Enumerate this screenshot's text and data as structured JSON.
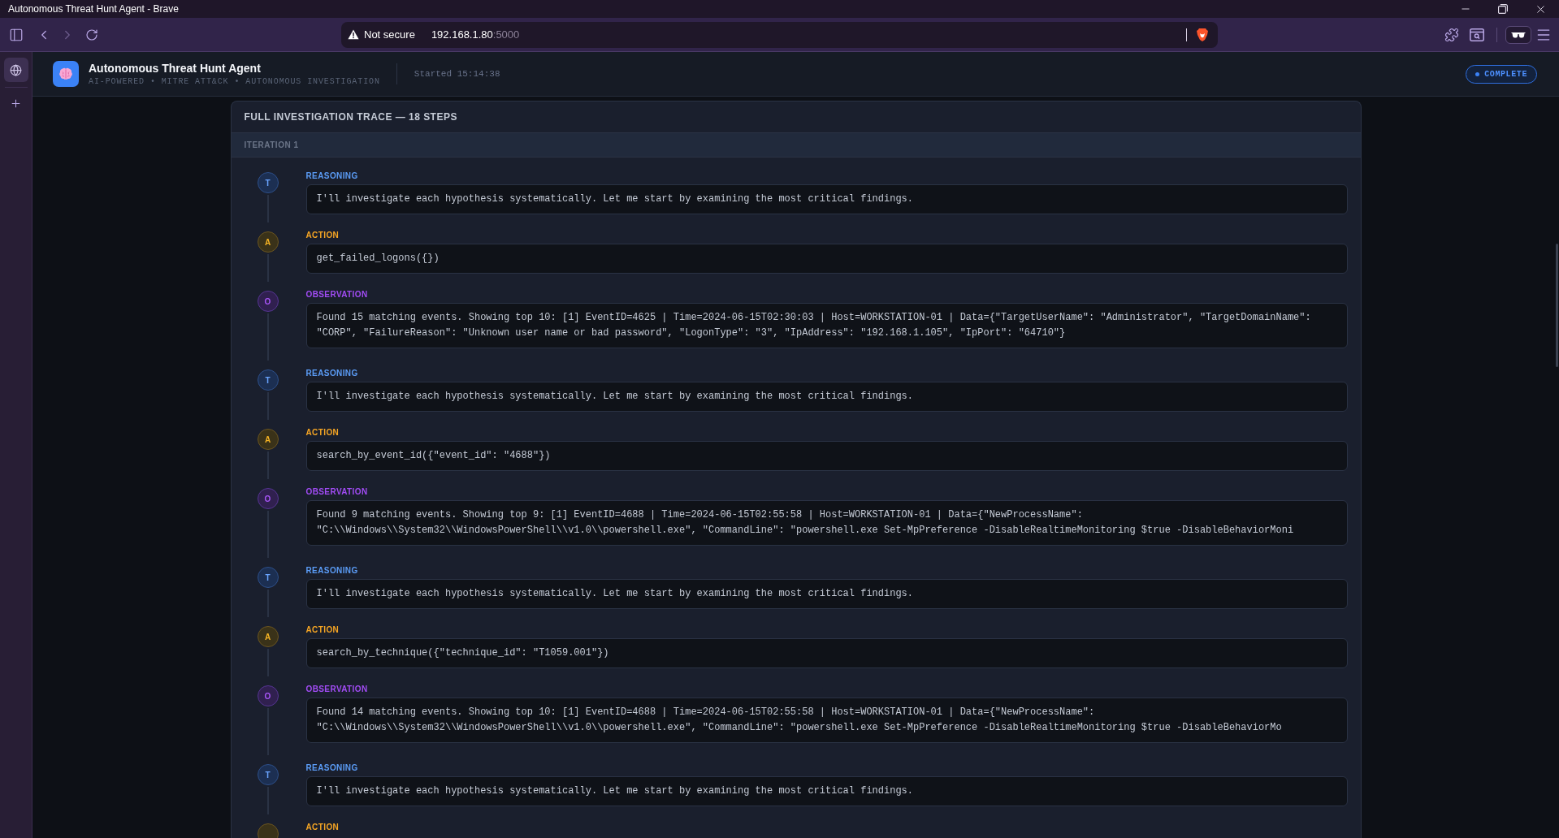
{
  "window": {
    "title": "Autonomous Threat Hunt Agent - Brave"
  },
  "address_bar": {
    "security_label": "Not secure",
    "host": "192.168.1.80",
    "port": ":5000"
  },
  "app_header": {
    "title": "Autonomous Threat Hunt Agent",
    "subtitle": "AI-POWERED • MITRE ATT&CK • AUTONOMOUS INVESTIGATION",
    "started": "Started 15:14:38",
    "status": "COMPLETE"
  },
  "trace": {
    "title": "FULL INVESTIGATION TRACE — 18 STEPS",
    "iterations": [
      {
        "label": "ITERATION 1",
        "steps": [
          {
            "kind": "reasoning",
            "badge": "T",
            "label": "REASONING",
            "text": "I'll investigate each hypothesis systematically. Let me start by examining the most critical findings."
          },
          {
            "kind": "action",
            "badge": "A",
            "label": "ACTION",
            "text": "get_failed_logons({})"
          },
          {
            "kind": "observation",
            "badge": "O",
            "label": "OBSERVATION",
            "text": "Found 15 matching events. Showing top 10: [1] EventID=4625 | Time=2024-06-15T02:30:03 | Host=WORKSTATION-01 | Data={\"TargetUserName\": \"Administrator\", \"TargetDomainName\": \"CORP\", \"FailureReason\": \"Unknown user name or bad password\", \"LogonType\": \"3\", \"IpAddress\": \"192.168.1.105\", \"IpPort\": \"64710\"}"
          },
          {
            "kind": "reasoning",
            "badge": "T",
            "label": "REASONING",
            "text": "I'll investigate each hypothesis systematically. Let me start by examining the most critical findings."
          },
          {
            "kind": "action",
            "badge": "A",
            "label": "ACTION",
            "text": "search_by_event_id({\"event_id\": \"4688\"})"
          },
          {
            "kind": "observation",
            "badge": "O",
            "label": "OBSERVATION",
            "text": "Found 9 matching events. Showing top 9: [1] EventID=4688 | Time=2024-06-15T02:55:58 | Host=WORKSTATION-01 | Data={\"NewProcessName\": \"C:\\\\Windows\\\\System32\\\\WindowsPowerShell\\\\v1.0\\\\powershell.exe\", \"CommandLine\": \"powershell.exe Set-MpPreference -DisableRealtimeMonitoring $true -DisableBehaviorMoni"
          },
          {
            "kind": "reasoning",
            "badge": "T",
            "label": "REASONING",
            "text": "I'll investigate each hypothesis systematically. Let me start by examining the most critical findings."
          },
          {
            "kind": "action",
            "badge": "A",
            "label": "ACTION",
            "text": "search_by_technique({\"technique_id\": \"T1059.001\"})"
          },
          {
            "kind": "observation",
            "badge": "O",
            "label": "OBSERVATION",
            "text": "Found 14 matching events. Showing top 10: [1] EventID=4688 | Time=2024-06-15T02:55:58 | Host=WORKSTATION-01 | Data={\"NewProcessName\": \"C:\\\\Windows\\\\System32\\\\WindowsPowerShell\\\\v1.0\\\\powershell.exe\", \"CommandLine\": \"powershell.exe Set-MpPreference -DisableRealtimeMonitoring $true -DisableBehaviorMo"
          },
          {
            "kind": "reasoning",
            "badge": "T",
            "label": "REASONING",
            "text": "I'll investigate each hypothesis systematically. Let me start by examining the most critical findings."
          },
          {
            "kind": "action",
            "label": "ACTION"
          }
        ]
      }
    ]
  }
}
